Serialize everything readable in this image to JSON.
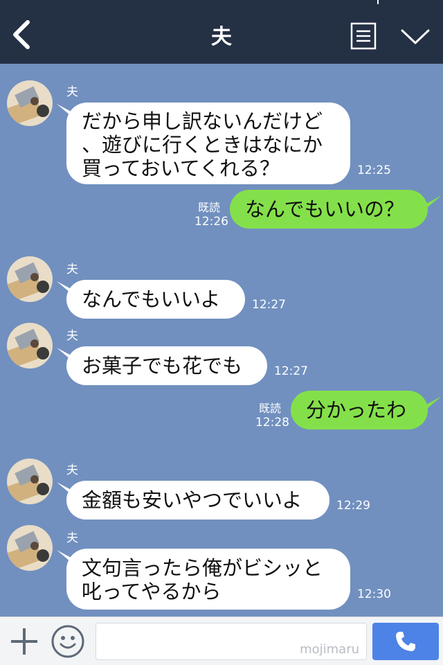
{
  "header": {
    "title": "夫",
    "back_icon": "chevron-left-icon",
    "menu_icon": "list-menu-icon",
    "dropdown_icon": "chevron-down-icon"
  },
  "colors": {
    "header_bg": "#243044",
    "chat_bg": "#7190bf",
    "incoming_bubble": "#ffffff",
    "outgoing_bubble": "#84e04a",
    "call_button": "#4d83e6"
  },
  "messages": [
    {
      "direction": "in",
      "sender": "夫",
      "text": "だから申し訳ないんだけど\n、遊びに行くときはなにか\n買っておいてくれる？",
      "time": "12:25"
    },
    {
      "direction": "out",
      "read": "既読",
      "text": "なんでもいいの？",
      "time": "12:26"
    },
    {
      "direction": "in",
      "sender": "夫",
      "text": "なんでもいいよ",
      "time": "12:27"
    },
    {
      "direction": "in",
      "sender": "夫",
      "text": "お菓子でも花でも",
      "time": "12:27"
    },
    {
      "direction": "out",
      "read": "既読",
      "text": "分かったわ",
      "time": "12:28"
    },
    {
      "direction": "in",
      "sender": "夫",
      "text": "金額も安いやつでいいよ",
      "time": "12:29"
    },
    {
      "direction": "in",
      "sender": "夫",
      "text": "文句言ったら俺がビシッと\n叱ってやるから",
      "time": "12:30"
    }
  ],
  "footer": {
    "plus_icon": "plus-icon",
    "emoji_icon": "smiley-icon",
    "input_placeholder": "",
    "watermark": "mojimaru",
    "call_icon": "phone-icon"
  }
}
